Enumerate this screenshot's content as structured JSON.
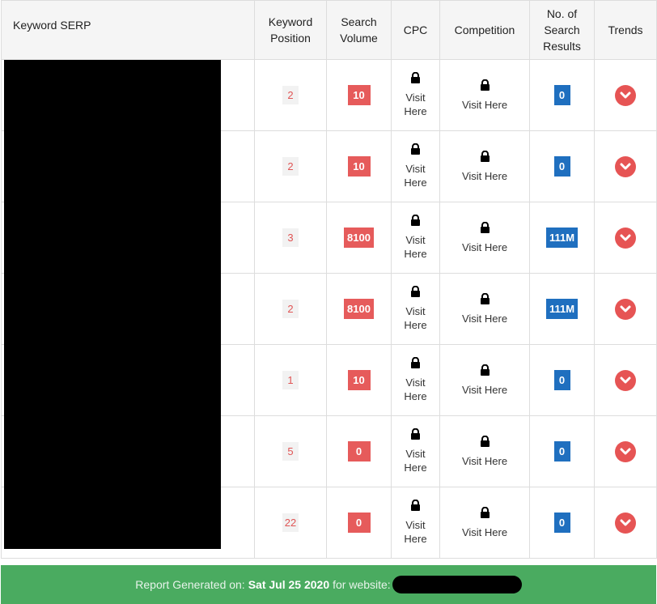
{
  "headers": {
    "keyword": "Keyword SERP",
    "position_l1": "Keyword",
    "position_l2": "Position",
    "volume_l1": "Search",
    "volume_l2": "Volume",
    "cpc": "CPC",
    "competition": "Competition",
    "results_l1": "No. of",
    "results_l2": "Search",
    "results_l3": "Results",
    "trends": "Trends"
  },
  "rows": [
    {
      "position": "2",
      "volume": "10",
      "cpc_l1": "Visit",
      "cpc_l2": "Here",
      "competition": "Visit Here",
      "results": "0"
    },
    {
      "position": "2",
      "volume": "10",
      "cpc_l1": "Visit",
      "cpc_l2": "Here",
      "competition": "Visit Here",
      "results": "0"
    },
    {
      "position": "3",
      "volume": "8100",
      "cpc_l1": "Visit",
      "cpc_l2": "Here",
      "competition": "Visit Here",
      "results": "111M"
    },
    {
      "position": "2",
      "volume": "8100",
      "cpc_l1": "Visit",
      "cpc_l2": "Here",
      "competition": "Visit Here",
      "results": "111M"
    },
    {
      "position": "1",
      "volume": "10",
      "cpc_l1": "Visit",
      "cpc_l2": "Here",
      "competition": "Visit Here",
      "results": "0"
    },
    {
      "position": "5",
      "volume": "0",
      "cpc_l1": "Visit",
      "cpc_l2": "Here",
      "competition": "Visit Here",
      "results": "0"
    },
    {
      "position": "22",
      "volume": "0",
      "cpc_l1": "Visit",
      "cpc_l2": "Here",
      "competition": "Visit Here",
      "results": "0"
    }
  ],
  "icons": {
    "lock": "lock-icon",
    "trend": "chevron-down-circle-icon"
  },
  "colors": {
    "position_text": "#e05555",
    "volume_badge": "#e65b5b",
    "results_badge": "#1f6fbf",
    "trend_button": "#e65454",
    "footer_bg": "#4aab60"
  },
  "footer": {
    "prefix": "Report Generated on:",
    "date": "Sat Jul 25 2020",
    "suffix": "for website:"
  }
}
